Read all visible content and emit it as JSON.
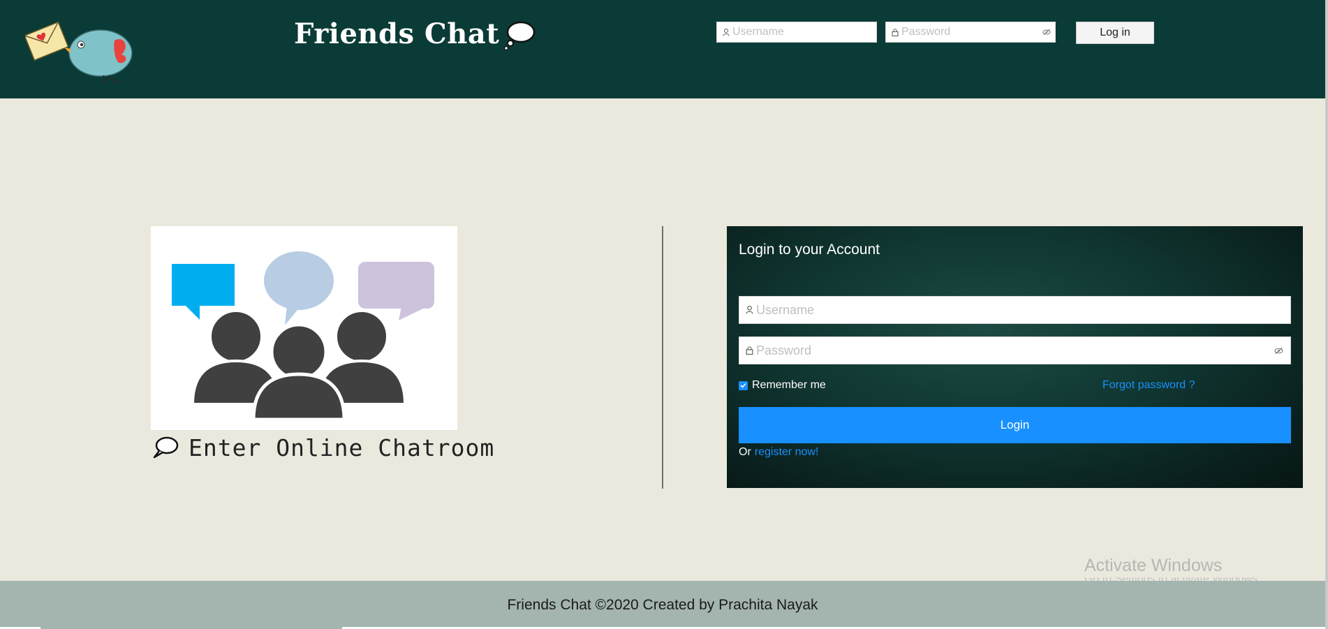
{
  "header": {
    "app_title": "Friends Chat",
    "username_placeholder": "Username",
    "password_placeholder": "Password",
    "login_button": "Log in",
    "background_color": "#0b3b36"
  },
  "main": {
    "chatroom_label": "Enter Online Chatroom",
    "login_card": {
      "title": "Login to your Account",
      "username_placeholder": "Username",
      "password_placeholder": "Password",
      "remember_me": "Remember me",
      "remember_checked": true,
      "forgot_password": "Forgot password ?",
      "login_button": "Login",
      "register_prefix": "Or",
      "register_link": "register now!",
      "accent_color": "#1890ff"
    }
  },
  "footer": {
    "text": "Friends Chat ©2020 Created by Prachita Nayak"
  },
  "watermark": {
    "title": "Activate Windows",
    "subtitle": "Go to Settings to activate Windows."
  },
  "icons": [
    "bird-mail-logo",
    "thought-bubble-icon",
    "user-icon",
    "lock-icon",
    "eye-invisible-icon",
    "checkbox-checked-icon",
    "chat-bubble-icon"
  ]
}
